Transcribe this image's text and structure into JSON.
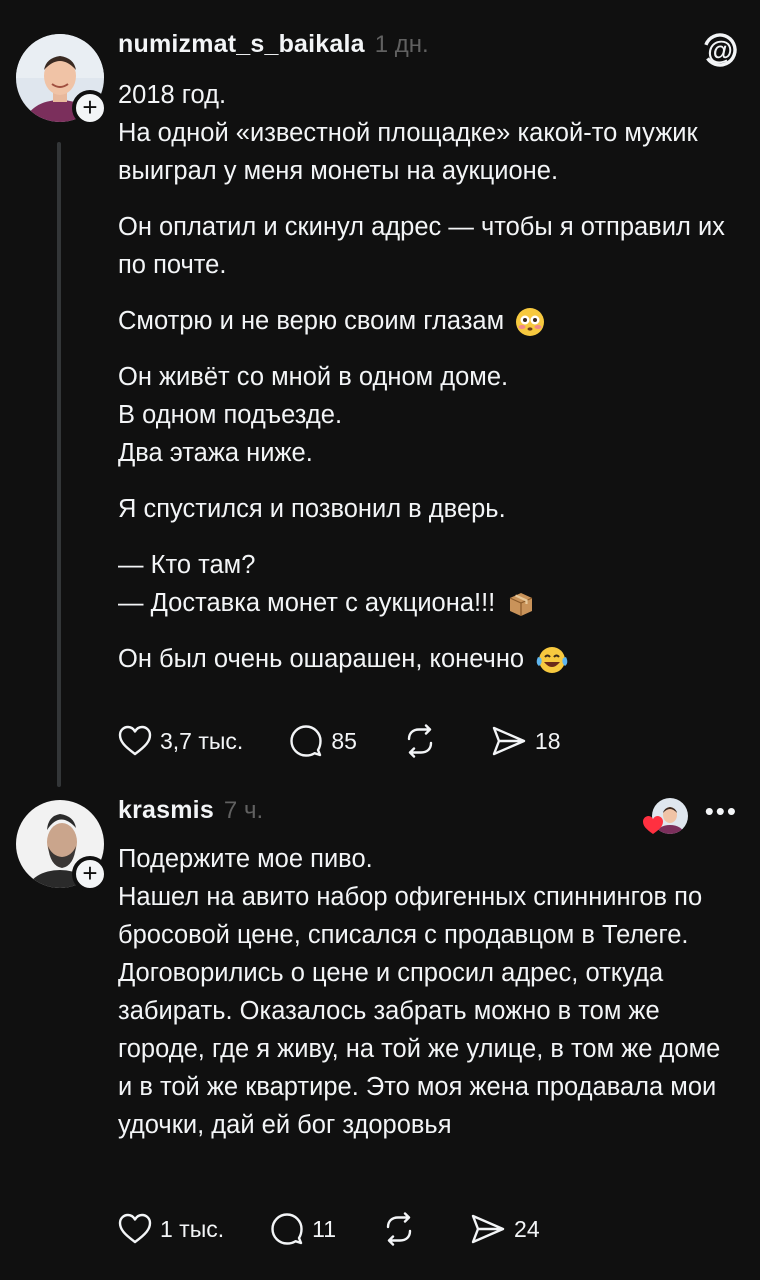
{
  "posts": [
    {
      "username": "numizmat_s_baikala",
      "time": "1 дн.",
      "paragraphs": [
        [
          "2018 год.",
          "На одной «известной площадке» какой-то мужик выиграл у меня монеты на аукционе."
        ],
        [
          "Он оплатил и скинул адрес — чтобы я отправил их по почте."
        ],
        [
          "Смотрю и не верю своим глазам"
        ],
        [
          "Он живёт со мной в одном доме.",
          "В одном подъезде.",
          "Два этажа ниже."
        ],
        [
          "Я спустился и позвонил в дверь."
        ],
        [
          "— Кто там?",
          "— Доставка монет с аукциона!!!"
        ],
        [
          "Он был очень ошарашен, конечно"
        ]
      ],
      "emojis": [
        "flushed-face",
        "package",
        "tears-of-joy"
      ],
      "likes": "3,7 тыс.",
      "replies": "85",
      "reposts": "",
      "shares": "18"
    },
    {
      "username": "krasmis",
      "time": "7 ч.",
      "lines": [
        "Подержите мое пиво.",
        "Нашел на авито набор офигенных спиннингов по бросовой цене, списался с продавцом в Телеге. Договорились о цене и спросил адрес, откуда забирать. Оказалось забрать можно в том же городе, где я живу, на той же улице, в том же доме и в той же квартире. Это моя жена продавала мои удочки, дай ей бог здоровья"
      ],
      "likes": "1 тыс.",
      "replies": "11",
      "reposts": "",
      "shares": "24"
    }
  ],
  "icons": {
    "logo": "threads-logo-icon",
    "like": "heart-icon",
    "reply": "comment-bubble-icon",
    "repost": "repost-icon",
    "share": "send-icon",
    "more": "more-icon"
  },
  "colors": {
    "background": "#101010",
    "text": "#f3f5f7",
    "muted": "#616161",
    "thread_line": "#333638",
    "heart_red": "#ff3040"
  }
}
